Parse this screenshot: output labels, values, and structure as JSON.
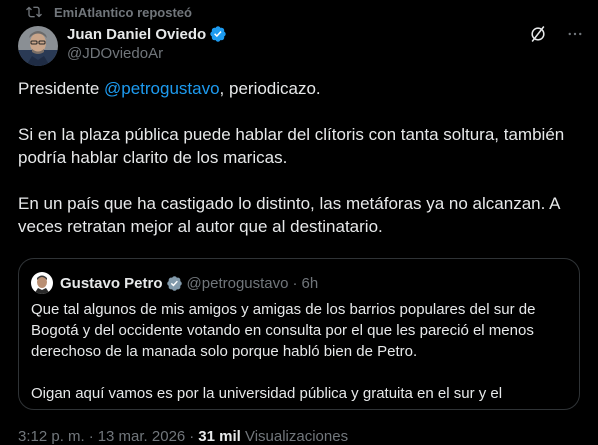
{
  "repost": {
    "text": "EmiAtlantico reposteó",
    "icon": "repost-icon"
  },
  "author": {
    "name": "Juan Daniel Oviedo",
    "handle": "@JDOviedoAr",
    "verified_icon": "verified-badge-icon",
    "avatar": "avatar"
  },
  "actions": {
    "grok_icon": "grok-icon",
    "more_icon": "more-icon"
  },
  "tweet": {
    "line1_prefix": "Presidente ",
    "line1_mention": "@petrogustavo",
    "line1_suffix": ", periodicazo.",
    "paragraph2": "Si en la plaza pública puede hablar del clítoris con tanta soltura, también podría hablar clarito de los maricas.",
    "paragraph3": "En un país que ha castigado lo distinto, las metáforas ya no alcanzan. A veces retratan mejor al autor que al destinatario."
  },
  "quote": {
    "name": "Gustavo Petro",
    "handle": "@petrogustavo",
    "dot": "·",
    "time": "6h",
    "paragraph1": "Que tal algunos de mis amigos y amigas de los barrios populares del sur de Bogotá y del occidente votando en consulta por el que les pareció el menos derechoso de la manada solo porque habló bien de Petro.",
    "paragraph2": "Oigan aquí vamos es por la universidad pública y gratuita en el sur y el"
  },
  "meta": {
    "time": "3:12 p. m.",
    "dot": "·",
    "date": "13 mar. 2026",
    "views_count": "31 mil",
    "views_label": "Visualizaciones"
  },
  "colors": {
    "background": "#000000",
    "text": "#e7e9ea",
    "secondary": "#71767b",
    "accent": "#1d9bf0",
    "border": "#2f3336"
  }
}
